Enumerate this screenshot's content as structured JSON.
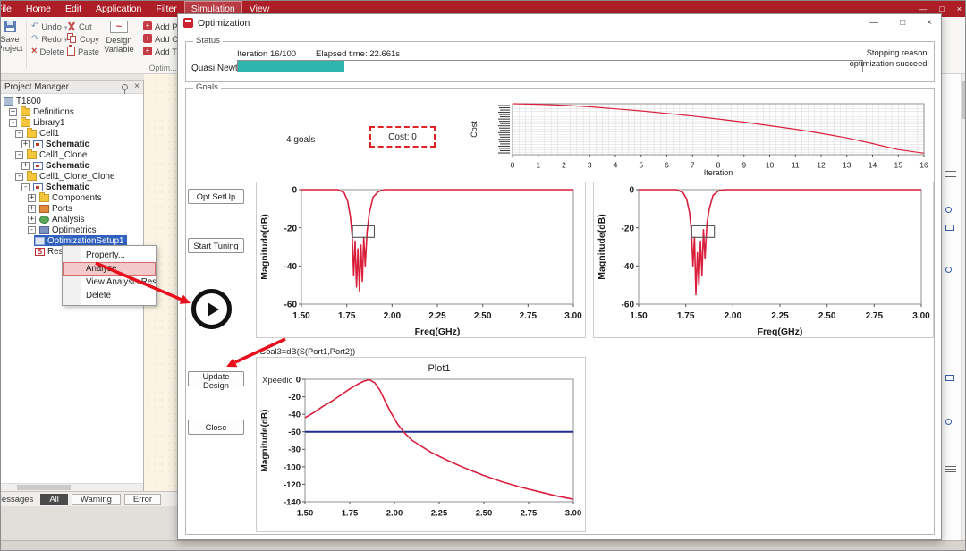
{
  "app": {
    "menu_items": [
      "File",
      "Home",
      "Edit",
      "Application",
      "Filter",
      "Simulation",
      "View"
    ],
    "active_menu": "Simulation",
    "window_controls": {
      "minimize": "—",
      "maximize": "□",
      "close": "×"
    }
  },
  "ribbon": {
    "save_line1": "Save",
    "save_line2": "Project",
    "undo": "Undo",
    "redo": "Redo",
    "delete": "Delete",
    "cut": "Cut",
    "copy": "Copy",
    "paste": "Paste",
    "design_variable": "Design Variable",
    "add_buttons": [
      "Add Para...",
      "Add Opti...",
      "Add Tun..."
    ],
    "group_label": "Optim..."
  },
  "project_manager": {
    "title": "Project Manager",
    "tree": [
      {
        "label": "T1800",
        "depth": 0,
        "icon": "project"
      },
      {
        "label": "Definitions",
        "depth": 1,
        "expander": "+",
        "icon": "folder"
      },
      {
        "label": "Library1",
        "depth": 1,
        "expander": "-",
        "icon": "folder"
      },
      {
        "label": "Cell1",
        "depth": 2,
        "expander": "-",
        "icon": "folder"
      },
      {
        "label": "Schematic",
        "depth": 3,
        "expander": "+",
        "icon": "schematic",
        "bold": true
      },
      {
        "label": "Cell1_Clone",
        "depth": 2,
        "expander": "-",
        "icon": "folder"
      },
      {
        "label": "Schematic",
        "depth": 3,
        "expander": "+",
        "icon": "schematic",
        "bold": true
      },
      {
        "label": "Cell1_Clone_Clone",
        "depth": 2,
        "expander": "-",
        "icon": "folder"
      },
      {
        "label": "Schematic",
        "depth": 3,
        "expander": "-",
        "icon": "schematic",
        "bold": true
      },
      {
        "label": "Components",
        "depth": 4,
        "expander": "+",
        "icon": "folder"
      },
      {
        "label": "Ports",
        "depth": 4,
        "expander": "+",
        "icon": "ports"
      },
      {
        "label": "Analysis",
        "depth": 4,
        "expander": "+",
        "icon": "analysis"
      },
      {
        "label": "Optimetrics",
        "depth": 4,
        "expander": "-",
        "icon": "optimetrics"
      },
      {
        "label": "OptimizationSetup1",
        "depth": 5,
        "icon": "optsetup",
        "selected": true
      },
      {
        "label": "Res...",
        "depth": 5,
        "icon": "results"
      }
    ]
  },
  "context_menu": {
    "items": [
      {
        "label": "Property..."
      },
      {
        "label": "Analyze",
        "highlighted": true
      },
      {
        "label": "View Analysis Resul..."
      },
      {
        "label": "Delete"
      }
    ]
  },
  "messages": {
    "title": "Messages",
    "tabs": [
      "All",
      "Warning",
      "Error"
    ],
    "active_tab": "All"
  },
  "dialog": {
    "title": "Optimization",
    "window_controls": {
      "minimize": "—",
      "maximize": "□",
      "close": "×"
    },
    "status": {
      "group_label": "Status",
      "algorithm": "Quasi Newton",
      "iteration_text": "Iteration 16/100",
      "elapsed_text": "Elapsed time: 22.661s",
      "progress_percent": 17,
      "stopping_line1": "Stopping reason:",
      "stopping_line2": "optimization succeed!"
    },
    "goals": {
      "group_label": "Goals",
      "goal_count": "4 goals",
      "cost_label": "Cost: 0"
    },
    "side_buttons": [
      "Opt SetUp",
      "Start Tuning",
      "Update Design",
      "Close"
    ],
    "bottom_panel_label": "Goal3=dB(S(Port1,Port2))",
    "watermark": "Xpeedic"
  },
  "colors": {
    "menubar_red": "#ae1e27",
    "curve_red": "#da1f3d",
    "progress_teal": "#2fb5ae",
    "selection_blue": "#3060c0",
    "goal_line_blue": "#222a8e",
    "cost_box_red": "#e02424"
  },
  "chart_data": [
    {
      "id": "cost-iteration-chart",
      "type": "line",
      "title": "",
      "xlabel": "Iteration",
      "ylabel": "Cost",
      "xlim": [
        0,
        16
      ],
      "ylim": [
        0,
        1
      ],
      "xticks": [
        0,
        1,
        2,
        3,
        4,
        5,
        6,
        7,
        8,
        9,
        10,
        11,
        12,
        13,
        14,
        15,
        16
      ],
      "yticks": [],
      "grid": true,
      "series": [
        {
          "name": "cost",
          "color": "#da1f3d",
          "width": 1.2,
          "x": [
            0,
            1,
            2,
            3,
            4,
            5,
            6,
            7,
            8,
            9,
            10,
            11,
            12,
            13,
            14,
            15,
            16
          ],
          "y": [
            1.0,
            0.99,
            0.97,
            0.94,
            0.9,
            0.86,
            0.81,
            0.76,
            0.7,
            0.64,
            0.57,
            0.5,
            0.42,
            0.33,
            0.22,
            0.1,
            0.03
          ]
        }
      ]
    },
    {
      "id": "goal-plot-1",
      "type": "line",
      "title": "",
      "xlabel": "Freq(GHz)",
      "ylabel": "Magnitude(dB)",
      "xlim": [
        1.5,
        3.0
      ],
      "ylim": [
        -60,
        0
      ],
      "xticks": [
        1.5,
        1.75,
        2.0,
        2.25,
        2.5,
        2.75,
        3.0
      ],
      "yticks": [
        0,
        -20,
        -40,
        -60
      ],
      "series": [
        {
          "name": "response",
          "color": "#da1f3d",
          "width": 1.6,
          "x": [
            1.5,
            1.7,
            1.735,
            1.755,
            1.77,
            1.78,
            1.788,
            1.796,
            1.804,
            1.812,
            1.82,
            1.828,
            1.836,
            1.844,
            1.852,
            1.862,
            1.875,
            1.895,
            1.925,
            1.96,
            3.0
          ],
          "y": [
            0,
            0,
            -1.5,
            -6,
            -14,
            -24,
            -45,
            -27,
            -51,
            -31,
            -53,
            -29,
            -48,
            -25,
            -40,
            -22,
            -12,
            -4,
            -1,
            0,
            0
          ]
        },
        {
          "name": "goal-marker",
          "color": "#555555",
          "width": 1.1,
          "x": [
            1.782,
            1.902,
            1.902,
            1.782,
            1.782
          ],
          "y": [
            -19,
            -19,
            -25,
            -25,
            -19
          ]
        }
      ]
    },
    {
      "id": "goal-plot-2",
      "type": "line",
      "title": "",
      "xlabel": "Freq(GHz)",
      "ylabel": "Magnitude(dB)",
      "xlim": [
        1.5,
        3.0
      ],
      "ylim": [
        -60,
        0
      ],
      "xticks": [
        1.5,
        1.75,
        2.0,
        2.25,
        2.5,
        2.75,
        3.0
      ],
      "yticks": [
        0,
        -20,
        -40,
        -60
      ],
      "series": [
        {
          "name": "response",
          "color": "#da1f3d",
          "width": 1.6,
          "x": [
            1.5,
            1.7,
            1.735,
            1.755,
            1.77,
            1.78,
            1.788,
            1.796,
            1.804,
            1.812,
            1.82,
            1.828,
            1.836,
            1.844,
            1.852,
            1.862,
            1.875,
            1.895,
            1.925,
            1.96,
            3.0
          ],
          "y": [
            0,
            0,
            -1.5,
            -5,
            -12,
            -22,
            -40,
            -25,
            -55,
            -33,
            -50,
            -27,
            -45,
            -21,
            -36,
            -18,
            -10,
            -3,
            -0.5,
            0,
            0
          ]
        },
        {
          "name": "goal-marker",
          "color": "#555555",
          "width": 1.1,
          "x": [
            1.782,
            1.902,
            1.902,
            1.782,
            1.782
          ],
          "y": [
            -19,
            -19,
            -25,
            -25,
            -19
          ]
        }
      ]
    },
    {
      "id": "goal-plot-3",
      "type": "line",
      "title": "Plot1",
      "xlabel": "",
      "ylabel": "Magnitude(dB)",
      "xlim": [
        1.5,
        3.0
      ],
      "ylim": [
        -140,
        0
      ],
      "xticks": [
        1.5,
        1.75,
        2.0,
        2.25,
        2.5,
        2.75,
        3.0
      ],
      "yticks": [
        0,
        -20,
        -40,
        -60,
        -80,
        -100,
        -120,
        -140
      ],
      "series": [
        {
          "name": "goal-line",
          "color": "#222a8e",
          "width": 2,
          "x": [
            1.5,
            3.0
          ],
          "y": [
            -60,
            -60
          ]
        },
        {
          "name": "response",
          "color": "#da1f3d",
          "width": 1.6,
          "x": [
            1.5,
            1.55,
            1.6,
            1.65,
            1.7,
            1.75,
            1.8,
            1.83,
            1.86,
            1.89,
            1.92,
            1.95,
            1.98,
            2.02,
            2.06,
            2.1,
            2.2,
            2.3,
            2.4,
            2.5,
            2.6,
            2.7,
            2.8,
            2.9,
            3.0
          ],
          "y": [
            -44,
            -38,
            -31,
            -25,
            -18,
            -11,
            -5,
            -2,
            -0.5,
            -4,
            -13,
            -26,
            -38,
            -52,
            -62,
            -70,
            -83,
            -93,
            -102,
            -110,
            -117,
            -123,
            -128,
            -133,
            -137
          ]
        }
      ]
    }
  ]
}
